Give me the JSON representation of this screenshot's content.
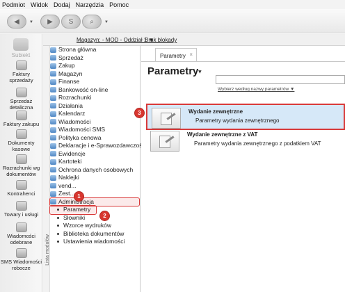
{
  "menu": [
    "Podmiot",
    "Widok",
    "Dodaj",
    "Narzędzia",
    "Pomoc"
  ],
  "rail": {
    "logo": "Subiekt",
    "items": [
      {
        "label": "Faktury sprzedaży"
      },
      {
        "label": "Sprzedaż detaliczna"
      },
      {
        "label": "Faktury zakupu"
      },
      {
        "label": "Dokumenty kasowe"
      },
      {
        "label": "Rozrachunki wg dokumentów"
      },
      {
        "label": "Kontrahenci"
      },
      {
        "label": "Towary i usługi"
      },
      {
        "label": "Wiadomości odebrane"
      },
      {
        "label": "SMS Wiadomości robocze"
      }
    ]
  },
  "subbar": {
    "magazyn": "Magazyn: - MOD - Oddział 1 ▼",
    "blokady": "Brak blokady"
  },
  "tree": {
    "gutter_label": "Lista modułów",
    "items": [
      {
        "label": "Strona główna"
      },
      {
        "label": "Sprzedaż"
      },
      {
        "label": "Zakup"
      },
      {
        "label": "Magazyn"
      },
      {
        "label": "Finanse"
      },
      {
        "label": "Bankowość on-line"
      },
      {
        "label": "Rozrachunki"
      },
      {
        "label": "Działania"
      },
      {
        "label": "Kalendarz"
      },
      {
        "label": "Wiadomości"
      },
      {
        "label": "Wiadomości SMS"
      },
      {
        "label": "Polityka cenowa"
      },
      {
        "label": "Deklaracje i e-Sprawozdawczość"
      },
      {
        "label": "Ewidencje"
      },
      {
        "label": "Kartoteki"
      },
      {
        "label": "Ochrona danych osobowych"
      },
      {
        "label": "Naklejki"
      },
      {
        "label": "vend..."
      },
      {
        "label": "Zest..."
      },
      {
        "label": "Administracja"
      }
    ],
    "children": [
      {
        "label": "Parametry"
      },
      {
        "label": "Słowniki"
      },
      {
        "label": "Wzorce wydruków"
      },
      {
        "label": "Biblioteka dokumentów"
      },
      {
        "label": "Ustawienia wiadomości"
      }
    ]
  },
  "badges": [
    "1",
    "2",
    "3"
  ],
  "content": {
    "tab": "Parametry",
    "tab_close": "×",
    "title": "Parametry",
    "search_placeholder": "",
    "filter": "Wybierz według nazwy parametrów ▼",
    "rows": [
      {
        "title": "Wydanie zewnętrzne",
        "subtitle": "Parametry wydania zewnętrznego"
      },
      {
        "title": "Wydanie zewnętrzne z VAT",
        "subtitle": "Parametry wydania zewnętrznego z podatkiem VAT"
      }
    ]
  },
  "colors": {
    "accent": "#d93a3a",
    "selection": "#d6e8f8"
  }
}
